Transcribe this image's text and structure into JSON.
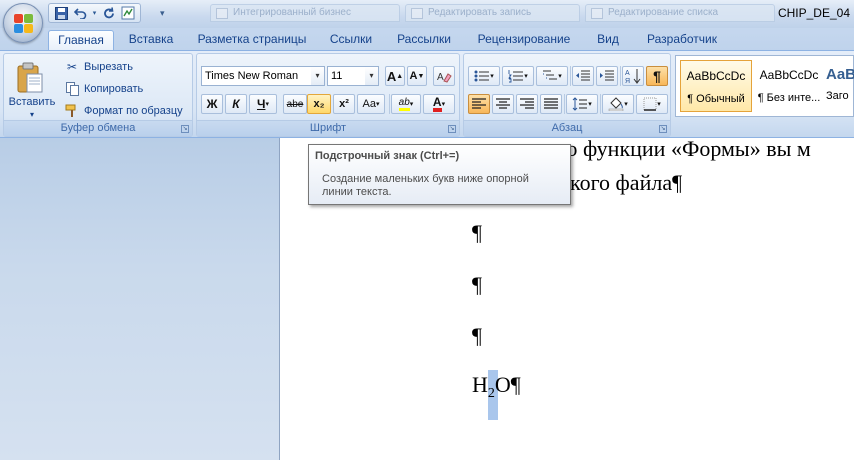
{
  "window": {
    "title": "CHIP_DE_04",
    "ghost_tabs": [
      "Интегрированный бизнес",
      "Редактировать запись",
      "Редактирование списка"
    ]
  },
  "quick_access": {
    "save_icon": "save-icon",
    "undo_icon": "undo-icon",
    "redo_icon": "redo-icon",
    "extra_icon": "document-map-icon"
  },
  "tabs": [
    {
      "label": "Главная",
      "active": true
    },
    {
      "label": "Вставка"
    },
    {
      "label": "Разметка страницы"
    },
    {
      "label": "Ссылки"
    },
    {
      "label": "Рассылки"
    },
    {
      "label": "Рецензирование"
    },
    {
      "label": "Вид"
    },
    {
      "label": "Разработчик"
    }
  ],
  "clipboard": {
    "group_label": "Буфер обмена",
    "paste_label": "Вставить",
    "cut_label": "Вырезать",
    "copy_label": "Копировать",
    "format_painter_label": "Формат по образцу"
  },
  "font": {
    "group_label": "Шрифт",
    "font_name": "Times New Roman",
    "font_size": "11",
    "bold": "Ж",
    "italic": "К",
    "underline": "Ч",
    "strike": "abe",
    "subscript": "x₂",
    "superscript": "x²",
    "change_case": "Aa",
    "grow": "A",
    "shrink": "A",
    "highlight": "ab",
    "font_color_letter": "A",
    "font_color": "#e02020",
    "highlight_color": "#ffff00"
  },
  "paragraph": {
    "group_label": "Абзац",
    "show_marks_glyph": "¶"
  },
  "styles": {
    "items": [
      {
        "sample": "AaBbCcDc",
        "name": "¶ Обычный",
        "selected": true
      },
      {
        "sample": "AaBbCcDc",
        "name": "¶ Без инте..."
      },
      {
        "sample": "AaB",
        "name": "Заго"
      }
    ]
  },
  "tooltip": {
    "title": "Подстрочный знак (Ctrl+=)",
    "description": "Создание маленьких букв ниже опорной линии текста."
  },
  "document": {
    "line1_visible": "ью функции «Формы» вы м",
    "line2_visible": "кого файла¶",
    "para_mark": "¶",
    "formula_h": "H",
    "formula_sub": "2",
    "formula_o": "O¶"
  },
  "colors": {
    "accent": "#15428b",
    "selection": "#a9c6ec"
  }
}
